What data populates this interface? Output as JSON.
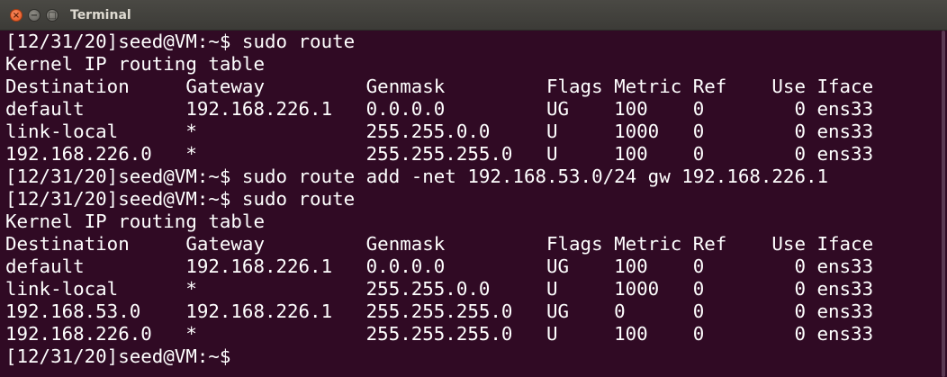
{
  "window": {
    "title": "Terminal",
    "buttons": {
      "close": "×",
      "minimize": "−",
      "maximize": "□"
    }
  },
  "terminal": {
    "lines": [
      "[12/31/20]seed@VM:~$ sudo route",
      "Kernel IP routing table",
      "Destination     Gateway         Genmask         Flags Metric Ref    Use Iface",
      "default         192.168.226.1   0.0.0.0         UG    100    0        0 ens33",
      "link-local      *               255.255.0.0     U     1000   0        0 ens33",
      "192.168.226.0   *               255.255.255.0   U     100    0        0 ens33",
      "[12/31/20]seed@VM:~$ sudo route add -net 192.168.53.0/24 gw 192.168.226.1",
      "[12/31/20]seed@VM:~$ sudo route",
      "Kernel IP routing table",
      "Destination     Gateway         Genmask         Flags Metric Ref    Use Iface",
      "default         192.168.226.1   0.0.0.0         UG    100    0        0 ens33",
      "link-local      *               255.255.0.0     U     1000   0        0 ens33",
      "192.168.53.0    192.168.226.1   255.255.255.0   UG    0      0        0 ens33",
      "192.168.226.0   *               255.255.255.0   U     100    0        0 ens33",
      "[12/31/20]seed@VM:~$ "
    ]
  },
  "colors": {
    "background": "#300a24",
    "text": "#ffffff",
    "titlebar": "#3c3b37",
    "close_button": "#e2541e"
  }
}
